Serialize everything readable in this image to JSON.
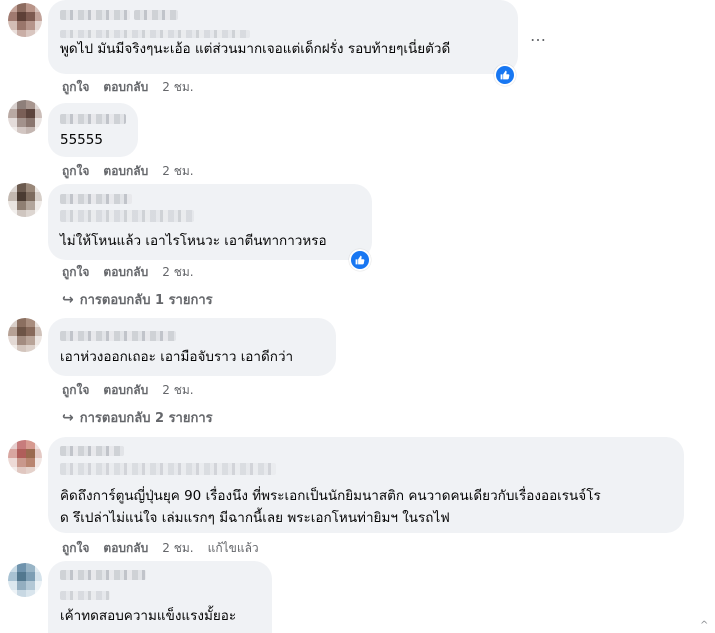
{
  "comments": [
    {
      "text": "พูดไป มันมีจริงๆนะเอ้อ แต่ส่วนมากเจอแต่เด็กฝรั่ง รอบท้ายๆเนี่ยตัวดี",
      "like_label": "ถูกใจ",
      "reply_label": "ตอบกลับ",
      "time": "2 ชม."
    },
    {
      "text": "55555",
      "like_label": "ถูกใจ",
      "reply_label": "ตอบกลับ",
      "time": "2 ชม."
    },
    {
      "text": "ไม่ให้โหนแล้ว เอาไรโหนวะ เอาตีนทากาวหรอ",
      "like_label": "ถูกใจ",
      "reply_label": "ตอบกลับ",
      "time": "2 ชม.",
      "replies": "การตอบกลับ 1 รายการ"
    },
    {
      "text": "เอาห่วงออกเถอะ เอามือจับราว เอาดีกว่า",
      "like_label": "ถูกใจ",
      "reply_label": "ตอบกลับ",
      "time": "2 ชม.",
      "replies": "การตอบกลับ 2 รายการ"
    },
    {
      "text_line1": "คิดถึงการ์ตูนญี่ปุ่นยุค 90 เรื่องนึง ที่พระเอกเป็นนักยิมนาสติก คนวาดคนเดียวกับเรื่องออเรนจ์โร",
      "text_line2": "ด รึเปล่าไม่แน่ใจ เล่มแรกๆ มีฉากนี้เลย พระเอกโหนท่ายิมฯ ในรถไฟ",
      "like_label": "ถูกใจ",
      "reply_label": "ตอบกลับ",
      "time": "2 ชม.",
      "edited": "แก้ไขแล้ว"
    },
    {
      "text": "เค้าทดสอบความแข็งแรงมั้ยอะ"
    }
  ],
  "more_icon": "…",
  "colors": {
    "bubble": "#f0f2f5",
    "meta": "#65676b",
    "like": "#1877f2"
  },
  "icons": [
    "more-options-icon",
    "like-reaction-icon",
    "reply-arrow-icon"
  ]
}
